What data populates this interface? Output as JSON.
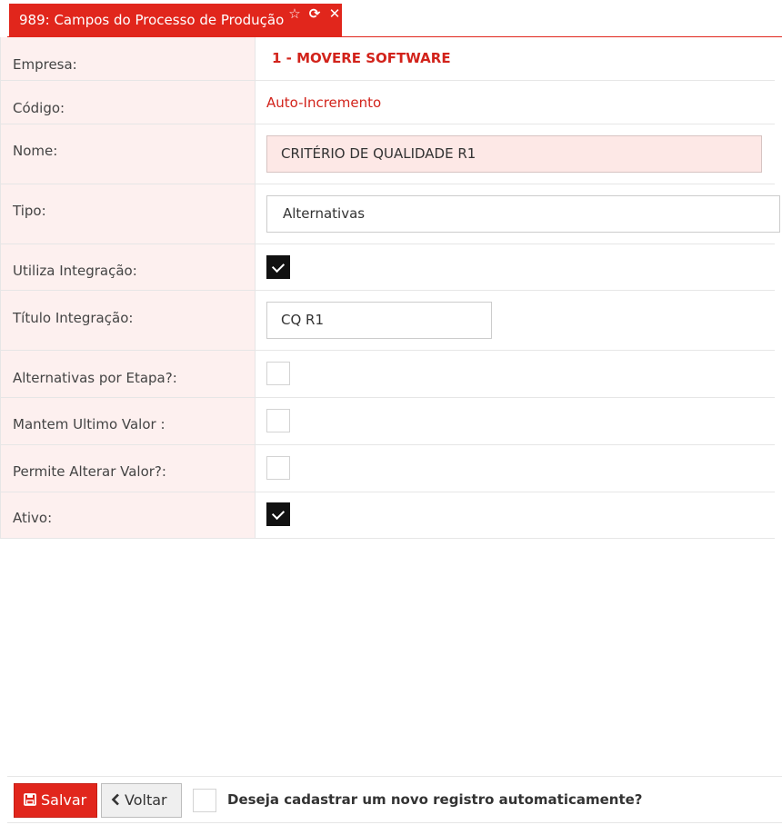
{
  "tab": {
    "title": "989: Campos do Processo de Produção",
    "icons": [
      "star-outline-icon",
      "refresh-icon",
      "close-icon"
    ],
    "accent_color": "#e1261c"
  },
  "form": {
    "empresa": {
      "label": "Empresa:",
      "value": "1 - MOVERE SOFTWARE"
    },
    "codigo": {
      "label": "Código:",
      "value": "Auto-Incremento"
    },
    "nome": {
      "label": "Nome:",
      "value": "CRITÉRIO DE QUALIDADE R1"
    },
    "tipo": {
      "label": "Tipo:",
      "value": "Alternativas"
    },
    "utiliza_integracao": {
      "label": "Utiliza Integração:",
      "checked": true
    },
    "titulo_integracao": {
      "label": "Título Integração:",
      "value": "CQ R1"
    },
    "alternativas_por_etapa": {
      "label": "Alternativas por Etapa?:",
      "checked": false
    },
    "mantem_ultimo_valor": {
      "label": "Mantem Ultimo Valor :",
      "checked": false
    },
    "permite_alterar_valor": {
      "label": "Permite Alterar Valor?:",
      "checked": false
    },
    "ativo": {
      "label": "Ativo:",
      "checked": true
    }
  },
  "footer": {
    "save_label": "Salvar",
    "back_label": "Voltar",
    "auto_new_label": "Deseja cadastrar um novo registro automaticamente?",
    "auto_new_checked": false
  }
}
